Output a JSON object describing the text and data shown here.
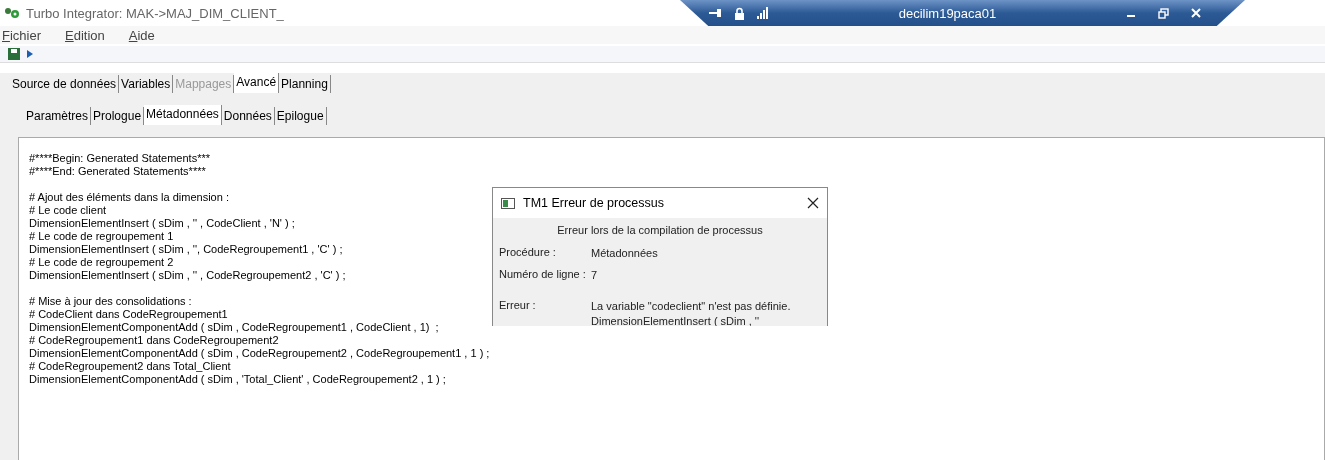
{
  "window": {
    "title": "Turbo Integrator:  MAK->MAJ_DIM_CLIENT_"
  },
  "remote_bar": {
    "host": "decilim19paca01"
  },
  "menu": [
    {
      "label": "Fichier"
    },
    {
      "label": "Edition"
    },
    {
      "label": "Aide"
    }
  ],
  "tabs": [
    {
      "label": "Source de données",
      "selected": false,
      "disabled": false
    },
    {
      "label": "Variables",
      "selected": false,
      "disabled": false
    },
    {
      "label": "Mappages",
      "selected": false,
      "disabled": true
    },
    {
      "label": "Avancé",
      "selected": true,
      "disabled": false
    },
    {
      "label": "Planning",
      "selected": false,
      "disabled": false
    }
  ],
  "subtabs": [
    {
      "label": "Paramètres",
      "selected": false
    },
    {
      "label": "Prologue",
      "selected": false
    },
    {
      "label": "Métadonnées",
      "selected": true
    },
    {
      "label": "Données",
      "selected": false
    },
    {
      "label": "Epilogue",
      "selected": false
    }
  ],
  "code_blocks": [
    [
      "#****Begin: Generated Statements***",
      "#****End: Generated Statements****"
    ],
    [
      "# Ajout des éléments dans la dimension :",
      "# Le code client",
      "DimensionElementInsert ( sDim , '' , CodeClient , 'N' ) ;",
      "# Le code de regroupement 1",
      "DimensionElementInsert ( sDim , '', CodeRegroupement1 , 'C' ) ;",
      "# Le code de regroupement 2",
      "DimensionElementInsert ( sDim , '' , CodeRegroupement2 , 'C' ) ;"
    ],
    [
      "# Mise à jour des consolidations :",
      "# CodeClient dans CodeRegroupement1",
      "DimensionElementComponentAdd ( sDim , CodeRegroupement1 , CodeClient , 1)  ;",
      "# CodeRegroupement1 dans CodeRegroupement2",
      "DimensionElementComponentAdd ( sDim , CodeRegroupement2 , CodeRegroupement1 , 1 ) ;",
      "# CodeRegroupement2 dans Total_Client",
      "DimensionElementComponentAdd ( sDim , 'Total_Client' , CodeRegroupement2 , 1 ) ;"
    ]
  ],
  "dialog": {
    "title": "TM1 Erreur de processus",
    "heading": "Erreur lors de la compilation de processus",
    "fields": [
      {
        "label": "Procédure :",
        "value": [
          "Métadonnées"
        ]
      },
      {
        "label": "Numéro de ligne :",
        "value": [
          "7"
        ]
      },
      {
        "label": "Erreur :",
        "value": [
          "La variable \"codeclient\" n'est pas définie.",
          "DimensionElementInsert ( sDim , ''"
        ]
      }
    ]
  }
}
